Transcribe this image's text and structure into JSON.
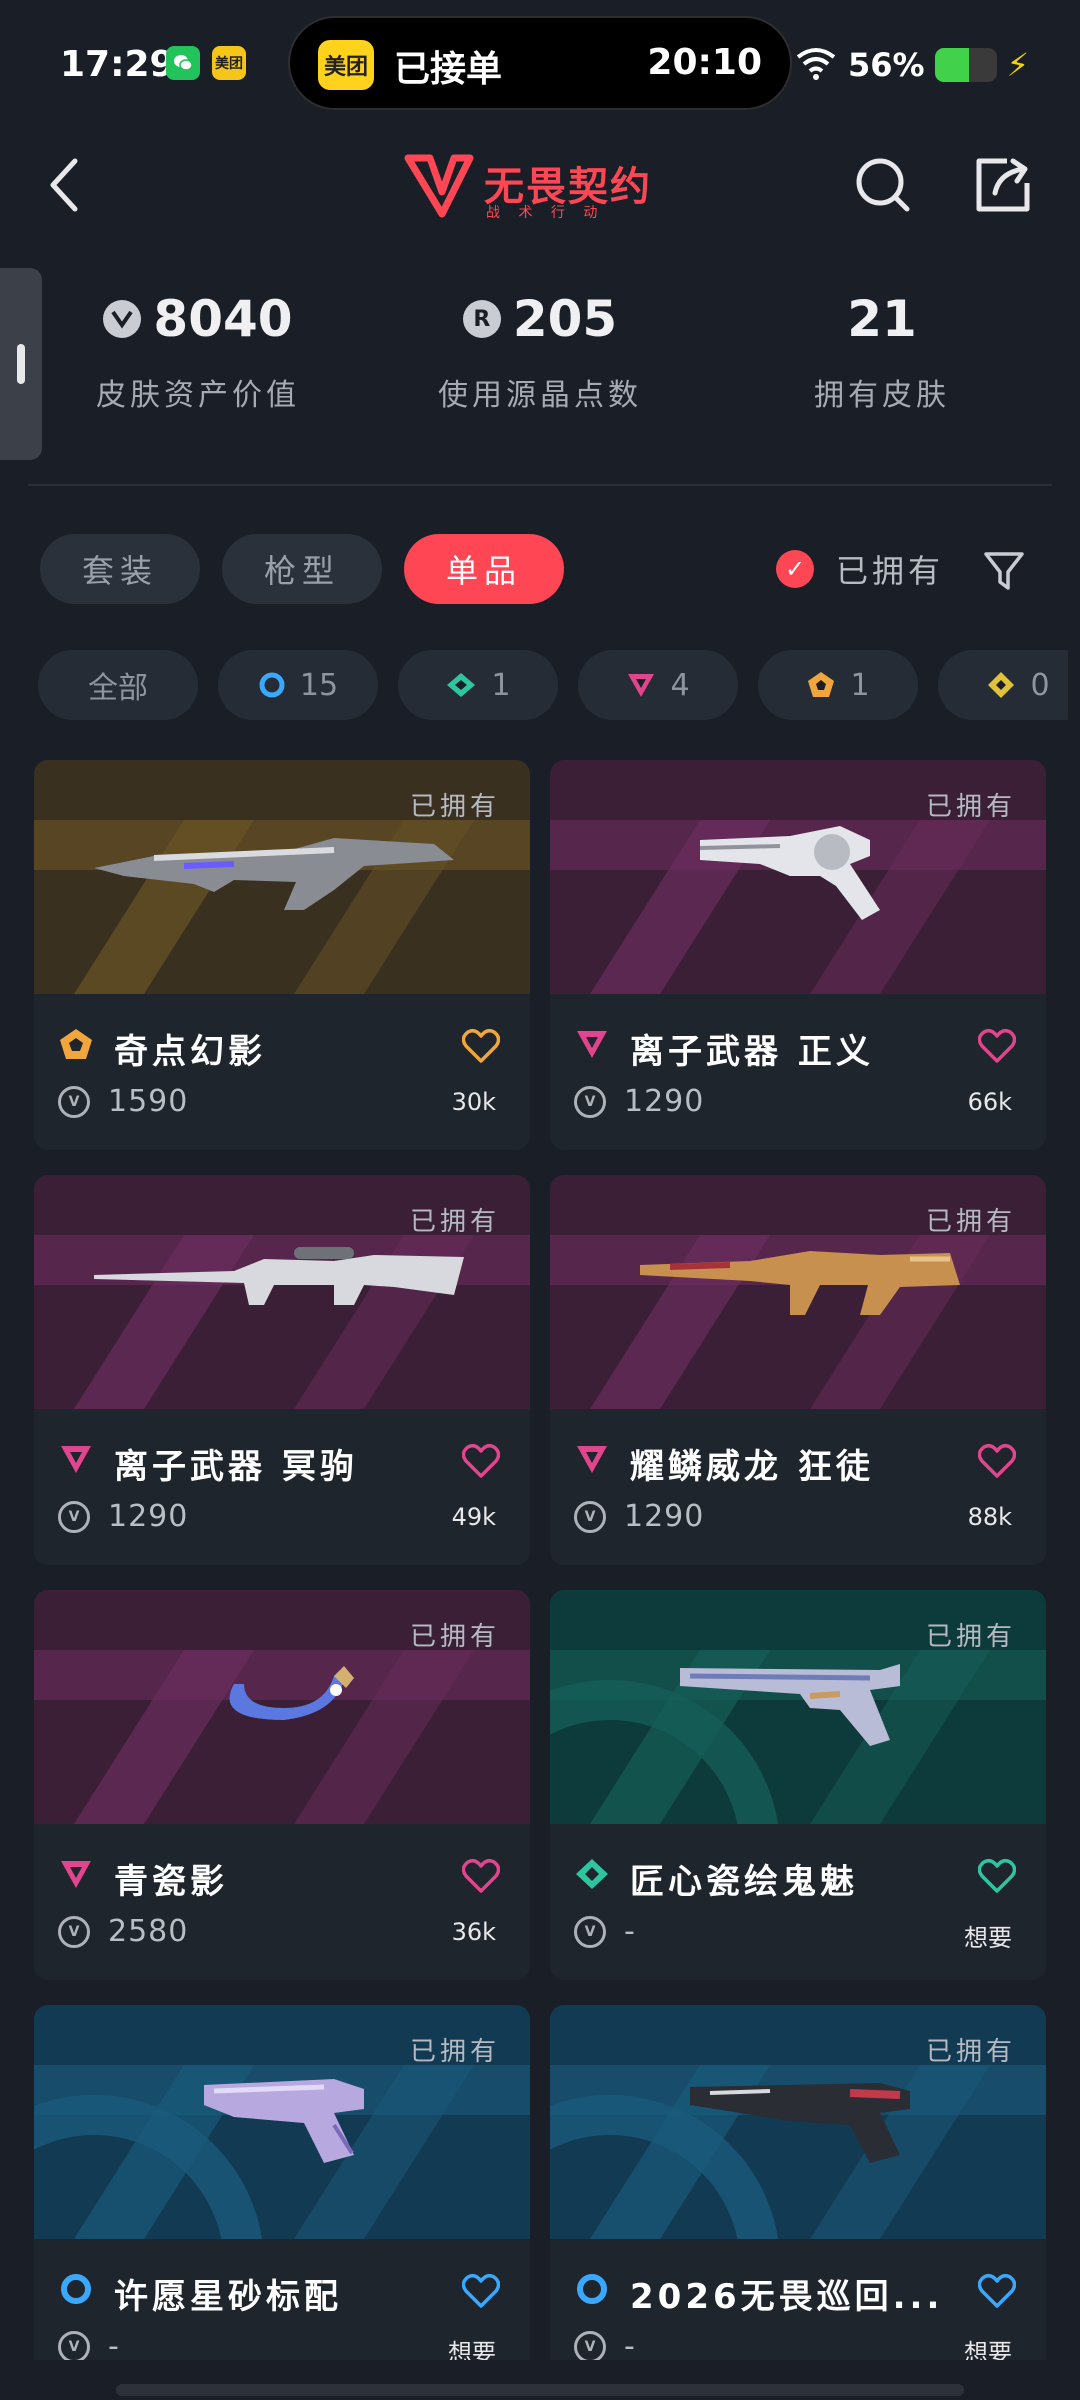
{
  "status_bar": {
    "time": "17:29",
    "app_icons": [
      "wechat-icon",
      "meituan-icon"
    ],
    "meituan_label": "美团",
    "island": {
      "logo": "美团",
      "text": "已接单",
      "time": "20:10"
    },
    "battery": "56%",
    "battery_level": 0.56
  },
  "header": {
    "logo_title": "无畏契约",
    "logo_subtitle": "战 术 行 动"
  },
  "stats": [
    {
      "value": "8040",
      "label": "皮肤资产价值",
      "icon": "vp-coin-icon"
    },
    {
      "value": "205",
      "label": "使用源晶点数",
      "icon": "radianite-coin-icon"
    },
    {
      "value": "21",
      "label": "拥有皮肤",
      "icon": ""
    }
  ],
  "tabs": [
    {
      "label": "套装",
      "active": false
    },
    {
      "label": "枪型",
      "active": false
    },
    {
      "label": "单品",
      "active": true
    }
  ],
  "owned_filter": {
    "label": "已拥有",
    "checked": true
  },
  "rarity_chips": [
    {
      "label": "全部",
      "count": "",
      "icon": ""
    },
    {
      "label": "",
      "count": "15",
      "icon": "select-ring-icon"
    },
    {
      "label": "",
      "count": "1",
      "icon": "deluxe-diamond-icon"
    },
    {
      "label": "",
      "count": "4",
      "icon": "premium-triangle-icon"
    },
    {
      "label": "",
      "count": "1",
      "icon": "exclusive-pentagon-icon"
    },
    {
      "label": "",
      "count": "0",
      "icon": "ultra-diamond-icon"
    }
  ],
  "colors": {
    "accent": "#ff4655",
    "select": "#3aa8ff",
    "deluxe": "#2ec6a0",
    "premium": "#e0458d",
    "exclusive": "#f0a63c",
    "ultra": "#e0c23a"
  },
  "skins": [
    {
      "name": "奇点幻影",
      "price": "1590",
      "likes": "30k",
      "owned_tag": "已拥有",
      "rarity": "exclusive",
      "heart_color": "#f0a63c",
      "bg": "gold"
    },
    {
      "name": "离子武器 正义",
      "price": "1290",
      "likes": "66k",
      "owned_tag": "已拥有",
      "rarity": "premium",
      "heart_color": "#e0458d",
      "bg": "purple"
    },
    {
      "name": "离子武器 冥驹",
      "price": "1290",
      "likes": "49k",
      "owned_tag": "已拥有",
      "rarity": "premium",
      "heart_color": "#e0458d",
      "bg": "purple"
    },
    {
      "name": "耀鳞威龙 狂徒",
      "price": "1290",
      "likes": "88k",
      "owned_tag": "已拥有",
      "rarity": "premium",
      "heart_color": "#e0458d",
      "bg": "purple"
    },
    {
      "name": "青瓷影",
      "price": "2580",
      "likes": "36k",
      "owned_tag": "已拥有",
      "rarity": "premium",
      "heart_color": "#e0458d",
      "bg": "purple"
    },
    {
      "name": "匠心瓷绘鬼魅",
      "price": "-",
      "likes": "想要",
      "owned_tag": "已拥有",
      "rarity": "deluxe",
      "heart_color": "#2ec6a0",
      "bg": "teal"
    },
    {
      "name": "许愿星砂标配",
      "price": "-",
      "likes": "想要",
      "owned_tag": "已拥有",
      "rarity": "select",
      "heart_color": "#3aa8ff",
      "bg": "blue"
    },
    {
      "name": "2026无畏巡回...",
      "price": "-",
      "likes": "想要",
      "owned_tag": "已拥有",
      "rarity": "select",
      "heart_color": "#3aa8ff",
      "bg": "blue"
    }
  ]
}
